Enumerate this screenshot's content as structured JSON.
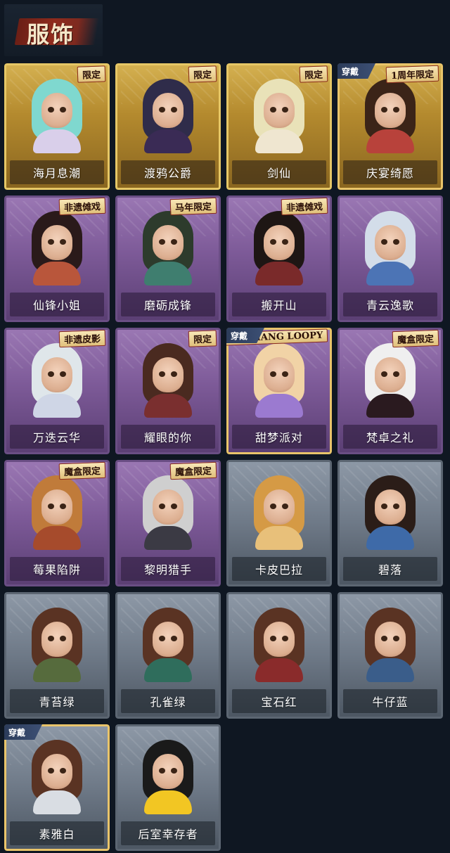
{
  "header": {
    "title": "服饰"
  },
  "rows": [
    [
      {
        "name": "海月息潮",
        "rarity": "gold",
        "tag": "限定",
        "equipped": false,
        "hair": "#7fd8cf",
        "body": "#d9cfea"
      },
      {
        "name": "渡鸦公爵",
        "rarity": "gold",
        "tag": "限定",
        "equipped": false,
        "hair": "#2f2c4a",
        "body": "#3a2b55"
      },
      {
        "name": "剑仙",
        "rarity": "gold",
        "tag": "限定",
        "equipped": false,
        "hair": "#e9e2b8",
        "body": "#efe6d0"
      },
      {
        "name": "庆宴绮愿",
        "rarity": "gold",
        "tag": "1周年限定",
        "equipped": true,
        "ribbon": "穿戴",
        "hair": "#3b2418",
        "body": "#b8423b"
      }
    ],
    [
      {
        "name": "仙锋小姐",
        "rarity": "purple",
        "tag": "非遗傩戏",
        "equipped": false,
        "hair": "#2a1a1a",
        "body": "#b9563b"
      },
      {
        "name": "磨砺成锋",
        "rarity": "purple",
        "tag": "马年限定",
        "equipped": false,
        "hair": "#2d3b2c",
        "body": "#3f7e6f"
      },
      {
        "name": "搬开山",
        "rarity": "purple",
        "tag": "非遗傩戏",
        "equipped": false,
        "hair": "#1e1614",
        "body": "#7a2a2a"
      },
      {
        "name": "青云逸歌",
        "rarity": "purple",
        "tag": "",
        "equipped": false,
        "hair": "#d3dde9",
        "body": "#4c74b5"
      }
    ],
    [
      {
        "name": "万迭云华",
        "rarity": "purple",
        "tag": "非遗皮影",
        "equipped": false,
        "hair": "#dfe6ea",
        "body": "#cfd6e6"
      },
      {
        "name": "耀眼的你",
        "rarity": "purple",
        "tag": "限定",
        "equipped": false,
        "hair": "#4a2a20",
        "body": "#7a2f2f"
      },
      {
        "name": "甜梦派对",
        "rarity": "purple",
        "tag": "ZANMANG LOOPY",
        "equipped": true,
        "ribbon": "穿戴",
        "hair": "#f1d3a6",
        "body": "#9b7ad0"
      },
      {
        "name": "梵卓之礼",
        "rarity": "purple",
        "tag": "魔盒限定",
        "equipped": false,
        "hair": "#efefef",
        "body": "#2a1a1f"
      }
    ],
    [
      {
        "name": "莓果陷阱",
        "rarity": "purple",
        "tag": "魔盒限定",
        "equipped": false,
        "hair": "#c07b3a",
        "body": "#a64b2c"
      },
      {
        "name": "黎明猎手",
        "rarity": "purple",
        "tag": "魔盒限定",
        "equipped": false,
        "hair": "#cfcfcf",
        "body": "#3b3a44"
      },
      {
        "name": "卡皮巴拉",
        "rarity": "grey",
        "tag": "",
        "equipped": false,
        "hair": "#d59a45",
        "body": "#e8c07a"
      },
      {
        "name": "碧落",
        "rarity": "grey",
        "tag": "",
        "equipped": false,
        "hair": "#2b1d18",
        "body": "#3e6aa8"
      }
    ],
    [
      {
        "name": "青苔绿",
        "rarity": "grey",
        "tag": "",
        "equipped": false,
        "hair": "#5a3323",
        "body": "#566b3d"
      },
      {
        "name": "孔雀绿",
        "rarity": "grey",
        "tag": "",
        "equipped": false,
        "hair": "#5a3323",
        "body": "#2f6d5c"
      },
      {
        "name": "宝石红",
        "rarity": "grey",
        "tag": "",
        "equipped": false,
        "hair": "#5a3323",
        "body": "#8a2b2b"
      },
      {
        "name": "牛仔蓝",
        "rarity": "grey",
        "tag": "",
        "equipped": false,
        "hair": "#5a3323",
        "body": "#3a5d8a"
      }
    ],
    [
      {
        "name": "素雅白",
        "rarity": "grey",
        "tag": "",
        "equipped": true,
        "ribbon": "穿戴",
        "hair": "#5a3323",
        "body": "#d9dde3"
      },
      {
        "name": "后室幸存者",
        "rarity": "grey",
        "tag": "",
        "equipped": false,
        "hair": "#1a1a1a",
        "body": "#f2c623"
      }
    ]
  ]
}
